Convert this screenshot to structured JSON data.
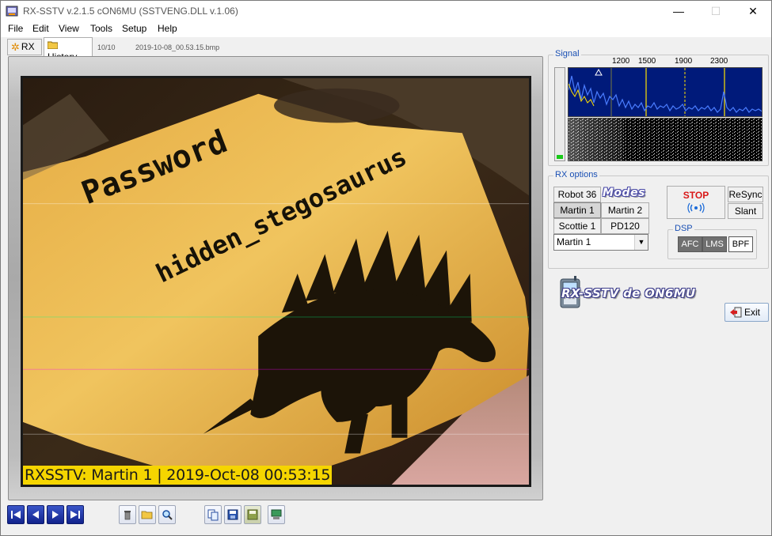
{
  "window": {
    "title": "RX-SSTV v.2.1.5 cON6MU (SSTVENG.DLL v.1.06)",
    "controls": [
      "—",
      "☐",
      "✕"
    ]
  },
  "menu": [
    "File",
    "Edit",
    "View",
    "Tools",
    "Setup",
    "Help"
  ],
  "tabs": [
    {
      "label": "RX",
      "active": false
    },
    {
      "label": "History",
      "active": true
    }
  ],
  "history": {
    "counter": "10/10",
    "filename": "2019-10-08_00.53.15.bmp"
  },
  "image": {
    "overlay_text": "RXSSTV: Martin 1 | 2019-Oct-08 00:53:15",
    "sign_text_line1": "Password",
    "sign_text_line2": "hidden_stegosaurus"
  },
  "signal": {
    "label": "Signal",
    "freq_marks": [
      "1200",
      "1500",
      "1900",
      "2300"
    ],
    "level": 0.04
  },
  "rx_options": {
    "label": "RX options",
    "modes_logo": "Modes",
    "mode_buttons": [
      "Robot 36",
      "Martin 1",
      "Martin 2",
      "Scottie 1",
      "PD120"
    ],
    "selected_mode": "Martin 1",
    "stop_label": "STOP",
    "resync_label": "ReSync",
    "slant_label": "Slant",
    "dsp": {
      "label": "DSP",
      "afc": "AFC",
      "lms": "LMS",
      "bpf": "BPF"
    }
  },
  "brand": {
    "text": "RX-SSTV de ON6MU"
  },
  "exit_label": "Exit",
  "colors": {
    "spectrum_bg": "#001a7a",
    "level_fill": "#19c919",
    "stop_text": "#d91818",
    "overlay_bg": "#f5d500"
  }
}
